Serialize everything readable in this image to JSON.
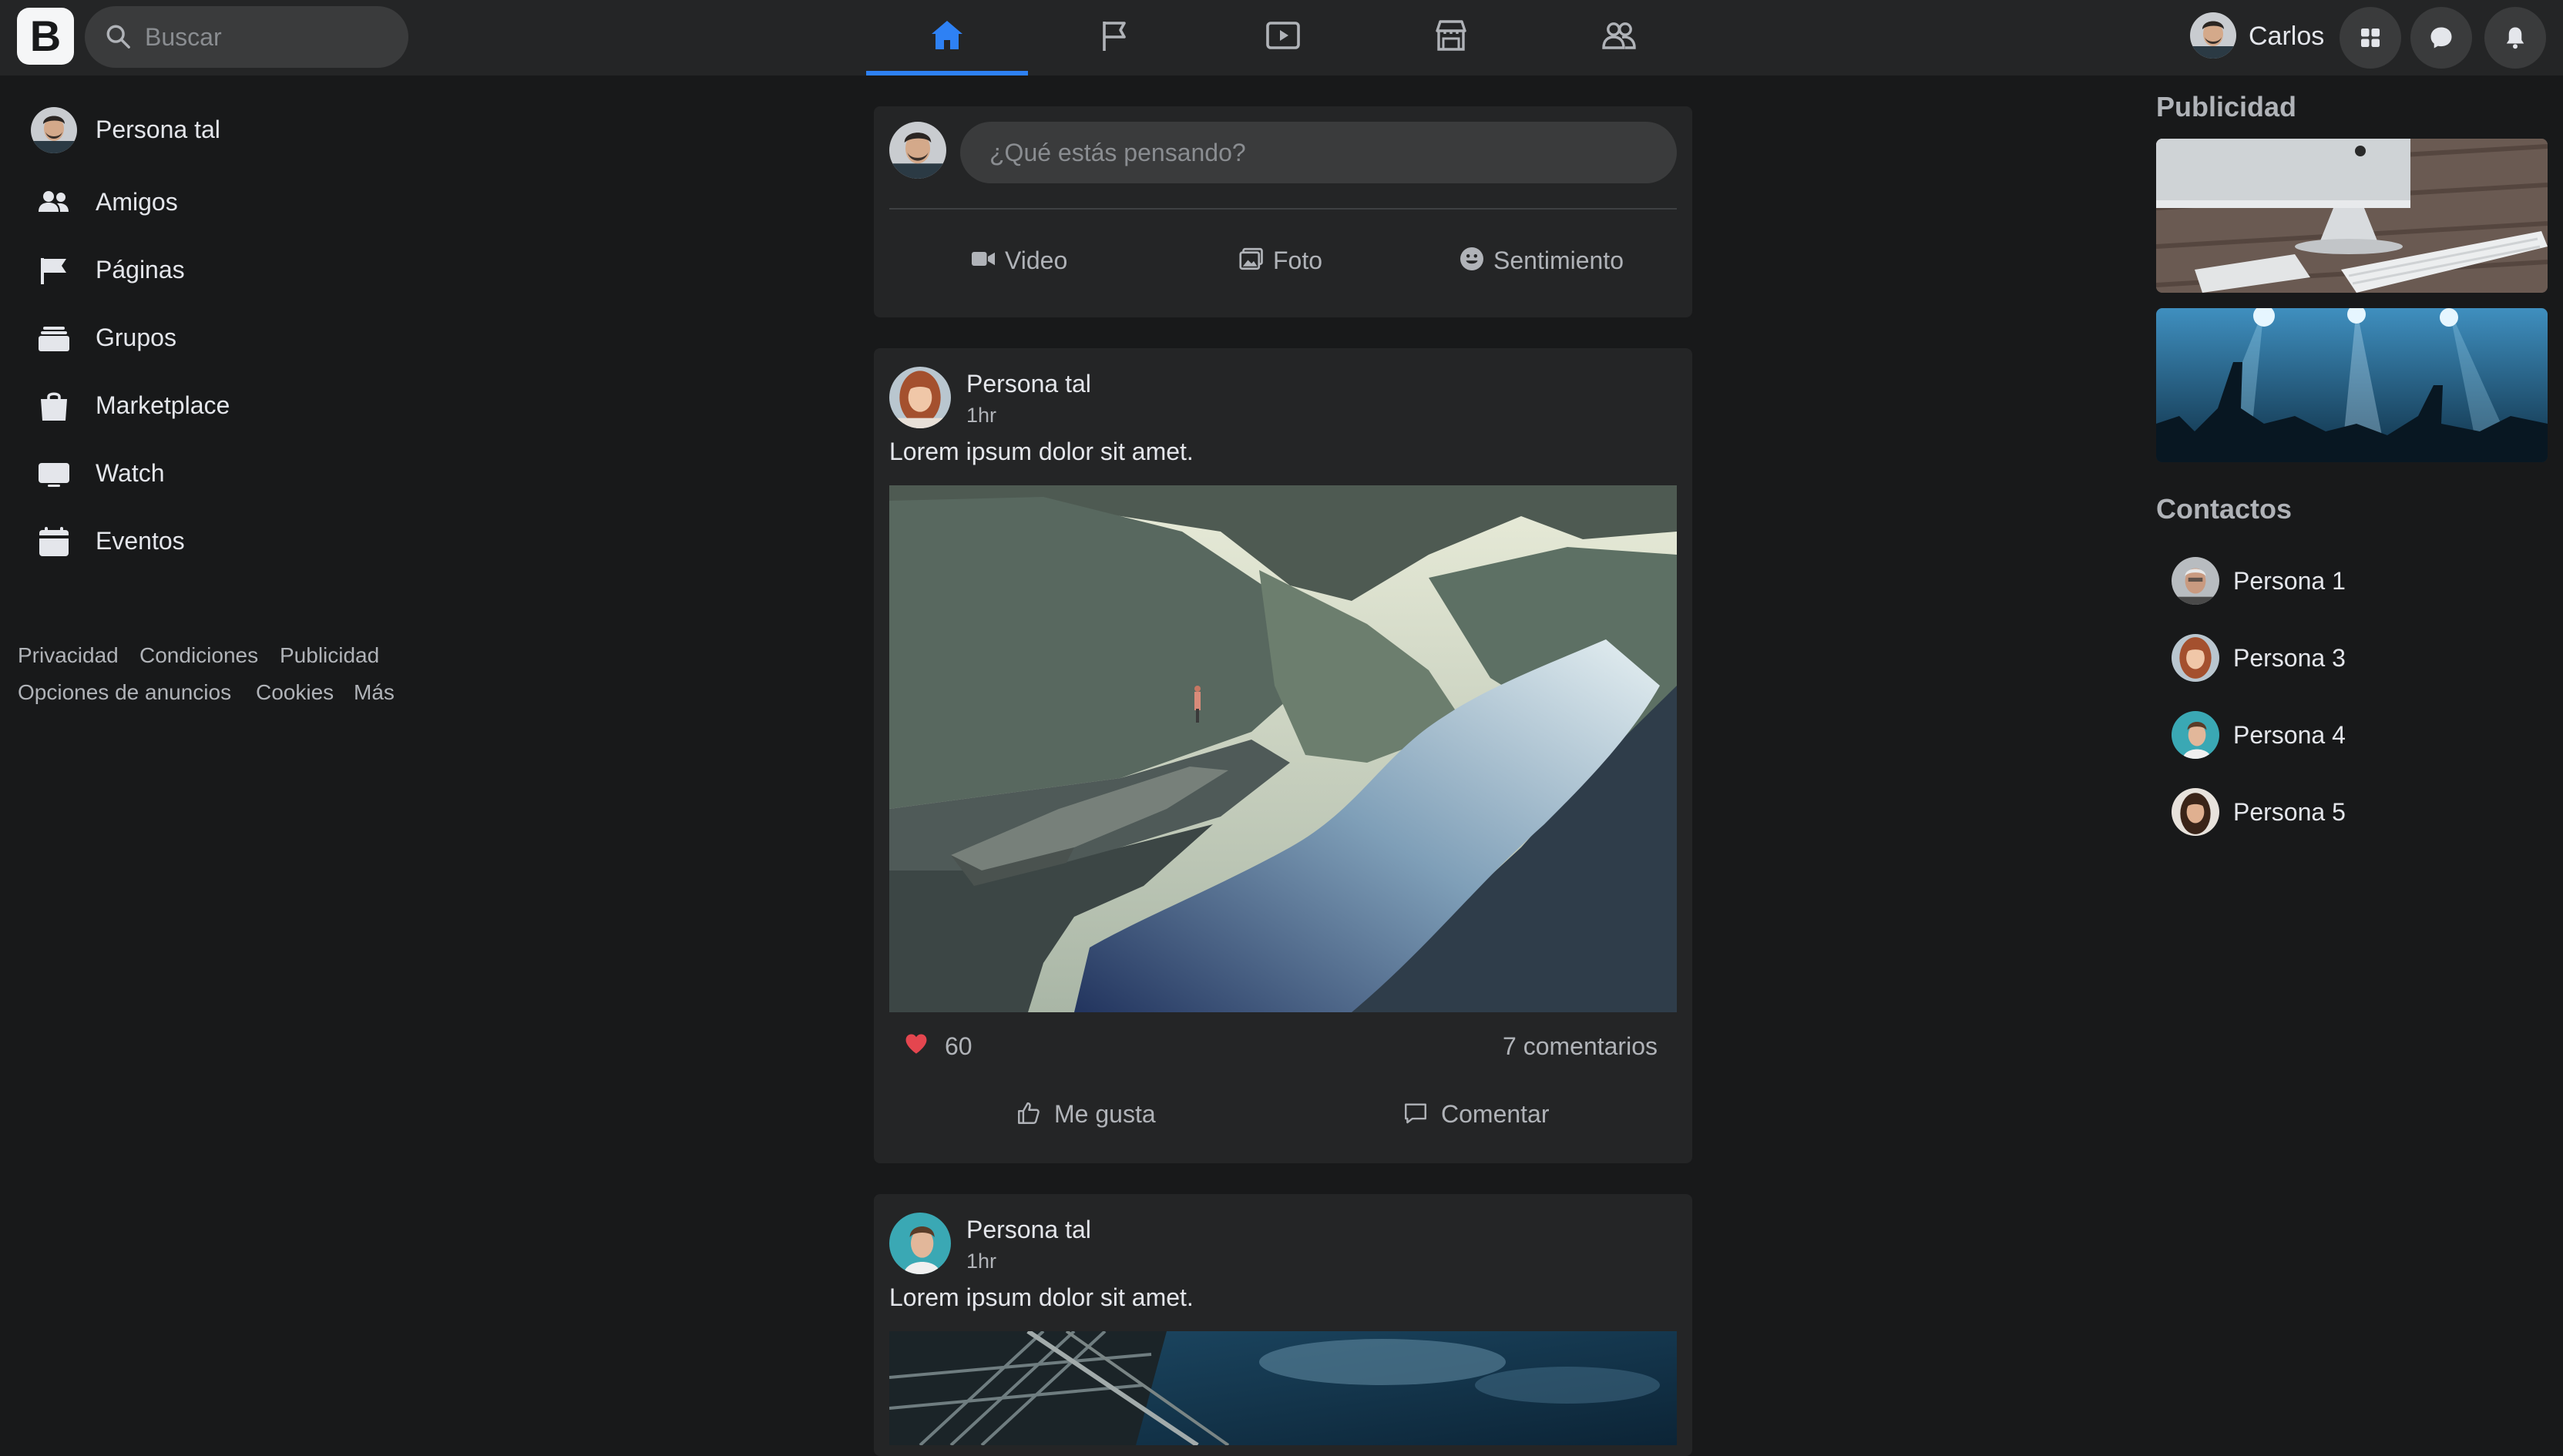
{
  "brand": {
    "logo_letter": "B"
  },
  "search": {
    "placeholder": "Buscar"
  },
  "nav_tabs": [
    {
      "name": "home",
      "icon": "home-icon",
      "active": true
    },
    {
      "name": "pages",
      "icon": "flag-icon",
      "active": false
    },
    {
      "name": "watch",
      "icon": "play-icon",
      "active": false
    },
    {
      "name": "marketplace",
      "icon": "store-icon",
      "active": false
    },
    {
      "name": "groups",
      "icon": "people-icon",
      "active": false
    }
  ],
  "user": {
    "name": "Carlos"
  },
  "header_buttons": [
    {
      "icon": "grid-icon"
    },
    {
      "icon": "messenger-icon"
    },
    {
      "icon": "bell-icon"
    }
  ],
  "sidebar": {
    "items": [
      {
        "label": "Persona tal",
        "icon": "avatar"
      },
      {
        "label": "Amigos",
        "icon": "friends-icon"
      },
      {
        "label": "Páginas",
        "icon": "flag-icon"
      },
      {
        "label": "Grupos",
        "icon": "groups-icon"
      },
      {
        "label": "Marketplace",
        "icon": "bag-icon"
      },
      {
        "label": "Watch",
        "icon": "tv-icon"
      },
      {
        "label": "Eventos",
        "icon": "calendar-icon"
      }
    ],
    "footer_links": [
      "Privacidad",
      "Condiciones",
      "Publicidad",
      "Opciones de anuncios",
      "Cookies",
      "Más"
    ]
  },
  "composer": {
    "placeholder": "¿Qué estás pensando?",
    "actions": [
      {
        "label": "Video",
        "icon": "video-camera-icon"
      },
      {
        "label": "Foto",
        "icon": "photo-icon"
      },
      {
        "label": "Sentimiento",
        "icon": "smiley-icon"
      }
    ]
  },
  "posts": [
    {
      "author": "Persona tal",
      "time": "1hr",
      "text": "Lorem ipsum dolor sit amet.",
      "photo": "fjord-cliff-landscape",
      "likes": "60",
      "comments": "7 comentarios",
      "actions": [
        "Me gusta",
        "Comentar"
      ]
    },
    {
      "author": "Persona tal",
      "time": "1hr",
      "text": "Lorem ipsum dolor sit amet.",
      "photo": "bridge-sky"
    }
  ],
  "right": {
    "ads_title": "Publicidad",
    "ads": [
      "desk-computer-ad",
      "concert-crowd-ad"
    ],
    "contacts_title": "Contactos",
    "contacts": [
      "Persona 1",
      "Persona 3",
      "Persona 4",
      "Persona 5"
    ]
  },
  "colors": {
    "background": "#18191a",
    "surface": "#242526",
    "input": "#3a3b3c",
    "accent": "#2e81f4",
    "like": "#e4464f"
  }
}
